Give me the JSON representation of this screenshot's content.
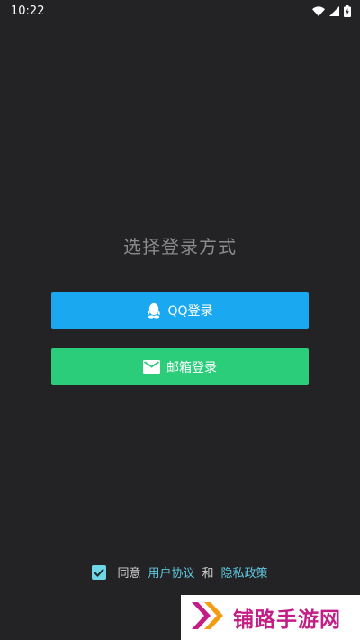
{
  "status_bar": {
    "time": "10:22",
    "icons": [
      "wifi-icon",
      "signal-icon",
      "battery-charging-icon"
    ]
  },
  "title": "选择登录方式",
  "buttons": {
    "qq": {
      "label": "QQ登录",
      "icon": "qq-penguin-icon",
      "color": "#1aa9f0"
    },
    "mail": {
      "label": "邮箱登录",
      "icon": "mail-icon",
      "color": "#2bcd7b"
    }
  },
  "agreement": {
    "checked": true,
    "prefix": "同意",
    "user_agreement": "用户协议",
    "conjunction": "和",
    "privacy_policy": "隐私政策"
  },
  "watermark": {
    "text": "铺路手游网",
    "icon": "double-chevron-logo-icon"
  },
  "colors": {
    "background": "#232325",
    "link": "#5fc7e0",
    "checkbox": "#6fd6e6",
    "watermark_text": "#c21e86"
  }
}
